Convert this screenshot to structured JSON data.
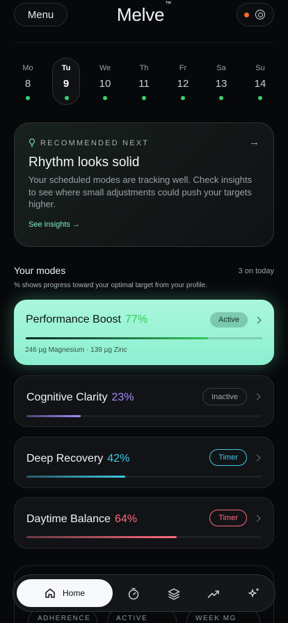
{
  "header": {
    "menu_label": "Menu",
    "brand": "Melve",
    "brand_mark": "™",
    "status_dot_color": "#ff6a2b"
  },
  "week": {
    "days": [
      {
        "name": "Mo",
        "num": "8",
        "selected": false
      },
      {
        "name": "Tu",
        "num": "9",
        "selected": true
      },
      {
        "name": "We",
        "num": "10",
        "selected": false
      },
      {
        "name": "Th",
        "num": "11",
        "selected": false
      },
      {
        "name": "Fr",
        "num": "12",
        "selected": false
      },
      {
        "name": "Sa",
        "num": "13",
        "selected": false
      },
      {
        "name": "Su",
        "num": "14",
        "selected": false
      }
    ],
    "dot_color": "#3ad16a"
  },
  "recommendation": {
    "eyebrow": "RECOMMENDED NEXT",
    "title": "Rhythm looks solid",
    "body": "Your scheduled modes are tracking well. Check insights to see where small adjustments could push your targets higher.",
    "link": "See insights →"
  },
  "modes": {
    "title": "Your modes",
    "count": "3 on today",
    "note": "% shows progress toward your optimal target from your profile.",
    "items": [
      {
        "name": "Performance Boost",
        "pct": "77%",
        "progress": 0.77,
        "badge": "Active",
        "accent": "#34c759",
        "detail": "246 µg Magnesium · 139 µg Zinc"
      },
      {
        "name": "Cognitive Clarity",
        "pct": "23%",
        "progress": 0.23,
        "badge": "Inactive",
        "accent": "#a58bff"
      },
      {
        "name": "Deep Recovery",
        "pct": "42%",
        "progress": 0.42,
        "badge": "Timer",
        "accent": "#3fc9e6"
      },
      {
        "name": "Daytime Balance",
        "pct": "64%",
        "progress": 0.64,
        "badge": "Timer",
        "accent": "#ff6b7d"
      }
    ]
  },
  "stats_peek": {
    "labels": [
      "ADHERENCE",
      "ACTIVE",
      "WEEK MG"
    ]
  },
  "nav": {
    "home_label": "Home",
    "icons": [
      "home-icon",
      "timer-icon",
      "layers-icon",
      "trend-icon",
      "sparkle-icon"
    ]
  }
}
